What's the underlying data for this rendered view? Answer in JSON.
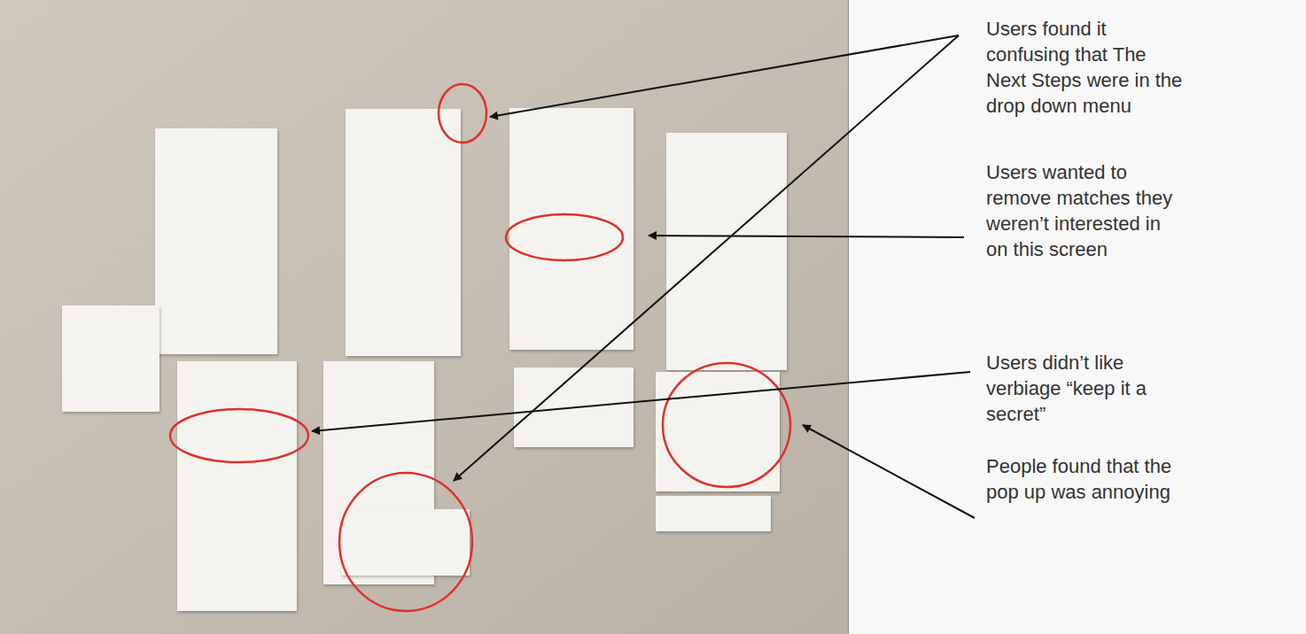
{
  "annotations": [
    {
      "lines": [
        "Users found it",
        "confusing that The",
        "Next Steps were in the",
        "drop down menu"
      ]
    },
    {
      "lines": [
        "Users wanted to",
        "remove matches they",
        "weren’t interested in",
        "on this screen"
      ]
    },
    {
      "lines": [
        "Users didn’t like",
        "verbiage “keep it a",
        "secret”"
      ]
    },
    {
      "lines": [
        "People found that the",
        "pop up was annoying"
      ]
    }
  ]
}
